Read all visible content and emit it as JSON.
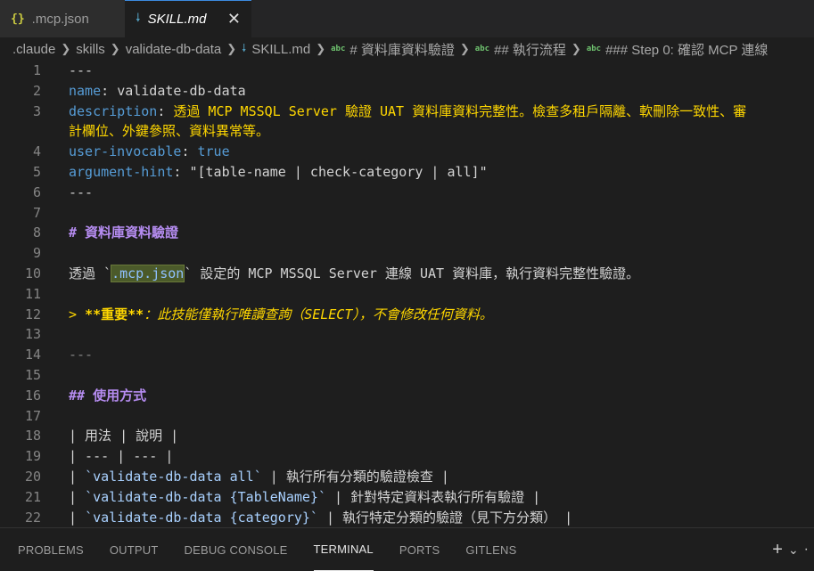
{
  "tabs": [
    {
      "icon": "{}",
      "label": ".mcp.json"
    },
    {
      "icon": "🠗",
      "label": "SKILL.md",
      "close": "✕"
    }
  ],
  "breadcrumb": {
    "parts": [
      ".claude",
      "skills",
      "validate-db-data"
    ],
    "file": "SKILL.md",
    "abc": "abc",
    "symbols": [
      "# 資料庫資料驗證",
      "## 執行流程",
      "### Step 0: 確認 MCP 連線"
    ]
  },
  "lines": {
    "n1": "1",
    "t1": "---",
    "n2": "2",
    "k2": "name",
    "v2": "validate-db-data",
    "n3": "3",
    "k3": "description",
    "v3": "透過 MCP MSSQL Server 驗證 UAT 資料庫資料完整性。檢查多租戶隔離、軟刪除一致性、審",
    "w3": "計欄位、外鍵參照、資料異常等。",
    "n4": "4",
    "k4": "user-invocable",
    "v4": "true",
    "n5": "5",
    "k5": "argument-hint",
    "v5": "\"[table-name | check-category | all]\"",
    "n6": "6",
    "t6": "---",
    "n7": "7",
    "n8": "8",
    "t8": "# 資料庫資料驗證",
    "n9": "9",
    "n10": "10",
    "a10": "透過 `",
    "b10": ".mcp.json",
    "c10": "` 設定的 MCP MSSQL Server 連線 UAT 資料庫，執行資料完整性驗證。",
    "n11": "11",
    "n12": "12",
    "a12": "> ",
    "b12": "**重要**",
    "c12": "：此技能僅執行唯讀查詢（SELECT），不會修改任何資料。",
    "n13": "13",
    "n14": "14",
    "t14": "---",
    "n15": "15",
    "n16": "16",
    "t16": "## 使用方式",
    "n17": "17",
    "n18": "18",
    "t18": "| 用法 | 說明 |",
    "n19": "19",
    "t19": "| --- | --- |",
    "n20": "20",
    "p20": "| ",
    "b20": "`validate-db-data all`",
    "s20": " | 執行所有分類的驗證檢查 |",
    "n21": "21",
    "p21": "| ",
    "b21": "`validate-db-data {TableName}`",
    "s21": " | 針對特定資料表執行所有驗證 |",
    "n22": "22",
    "p22": "| ",
    "b22": "`validate-db-data {category}`",
    "s22": " | 執行特定分類的驗證（見下方分類） |"
  },
  "panel": {
    "tabs": [
      "PROBLEMS",
      "OUTPUT",
      "DEBUG CONSOLE",
      "TERMINAL",
      "PORTS",
      "GITLENS"
    ],
    "active": "TERMINAL",
    "add": "+",
    "chevron": "⌄"
  }
}
